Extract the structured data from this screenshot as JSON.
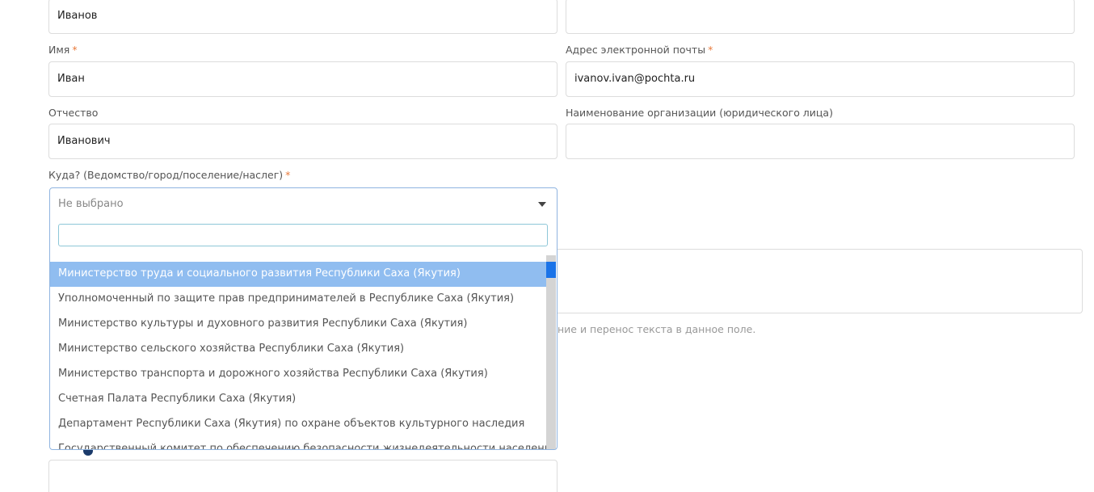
{
  "form": {
    "last_name": {
      "value": "Иванов"
    },
    "first_name": {
      "label": "Имя",
      "required_mark": "*",
      "value": "Иван"
    },
    "email": {
      "label": "Адрес электронной почты",
      "required_mark": "*",
      "value": "ivanov.ivan@pochta.ru"
    },
    "patronymic": {
      "label": "Отчество",
      "value": "Иванович"
    },
    "organization": {
      "label": "Наименование организации (юридического лица)",
      "value": ""
    },
    "recipient": {
      "label": "Куда? (Ведомство/город/поселение/наслег)",
      "required_mark": "*",
      "selected": "Не выбрано",
      "search_value": "",
      "options": [
        "Министерство труда и социального развития Республики Саха (Якутия)",
        "Уполномоченный по защите прав предпринимателей в Республике Саха (Якутия)",
        "Министерство культуры и духовного развития Республики Саха (Якутия)",
        "Министерство сельского хозяйства Республики Саха (Якутия)",
        "Министерство транспорта и дорожного хозяйства Республики Саха (Якутия)",
        "Счетная Палата Республики Саха (Якутия)",
        "Департамент Республики Саха (Якутия) по охране объектов культурного наследия",
        "Государственный комитет по обеспечению безопасности жизнедеятельности населения"
      ]
    },
    "hint_text": "ние и перенос текста в данное поле."
  },
  "colors": {
    "accent": "#1a73e8",
    "highlight": "#90bdf0",
    "required": "#e87a3b"
  }
}
